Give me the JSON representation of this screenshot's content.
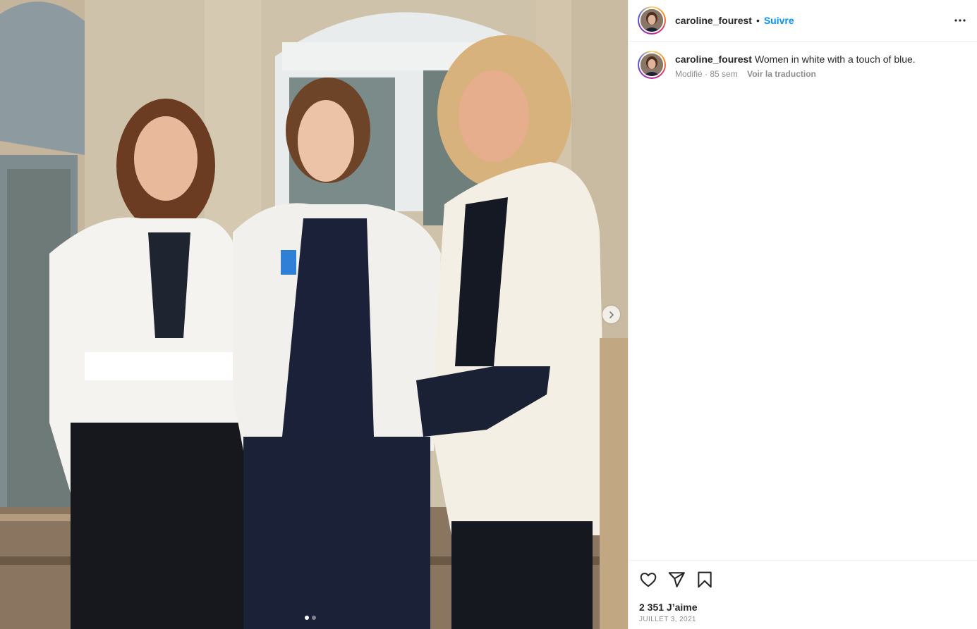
{
  "header": {
    "username": "caroline_fourest",
    "separator": "•",
    "follow_label": "Suivre"
  },
  "caption": {
    "username": "caroline_fourest",
    "text": "Women in white with a touch of blue.",
    "edited_label": "Modifié",
    "meta_separator": "·",
    "age": "85 sem",
    "translate_label": "Voir la traduction"
  },
  "carousel": {
    "slide_count": 2,
    "current_slide": 1
  },
  "actions": {
    "like_icon": "heart-icon",
    "share_icon": "paper-plane-icon",
    "save_icon": "bookmark-icon",
    "more_icon": "ellipsis-icon"
  },
  "stats": {
    "likes": "2 351 J’aime",
    "date": "JUILLET 3, 2021"
  },
  "colors": {
    "follow_blue": "#0095f6",
    "secondary_text": "#8e8e8e",
    "primary_text": "#262626"
  }
}
